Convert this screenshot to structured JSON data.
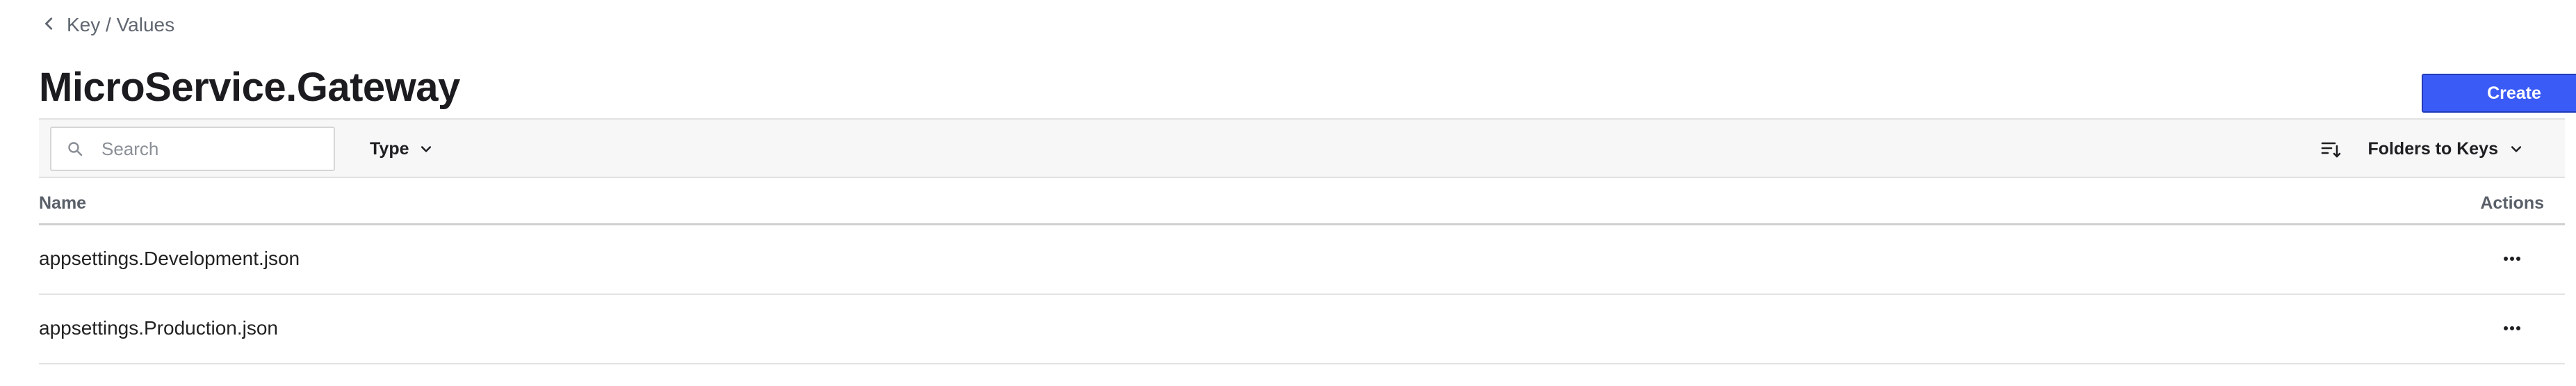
{
  "breadcrumb": {
    "label": "Key / Values",
    "icon": "chevron-left-icon"
  },
  "page": {
    "title": "MicroService.Gateway"
  },
  "header": {
    "create_label": "Create",
    "accent_color": "#3b5bf6"
  },
  "toolbar": {
    "search": {
      "placeholder": "Search",
      "value": "",
      "icon": "search-icon"
    },
    "type_filter": {
      "label": "Type",
      "icon": "chevron-down-icon"
    },
    "sort": {
      "label": "Folders to Keys",
      "icon": "sort-icon"
    }
  },
  "table": {
    "columns": {
      "name": "Name",
      "actions": "Actions"
    },
    "rows": [
      {
        "name": "appsettings.Development.json",
        "actions_icon": "more-horizontal-icon"
      },
      {
        "name": "appsettings.Production.json",
        "actions_icon": "more-horizontal-icon"
      }
    ]
  }
}
